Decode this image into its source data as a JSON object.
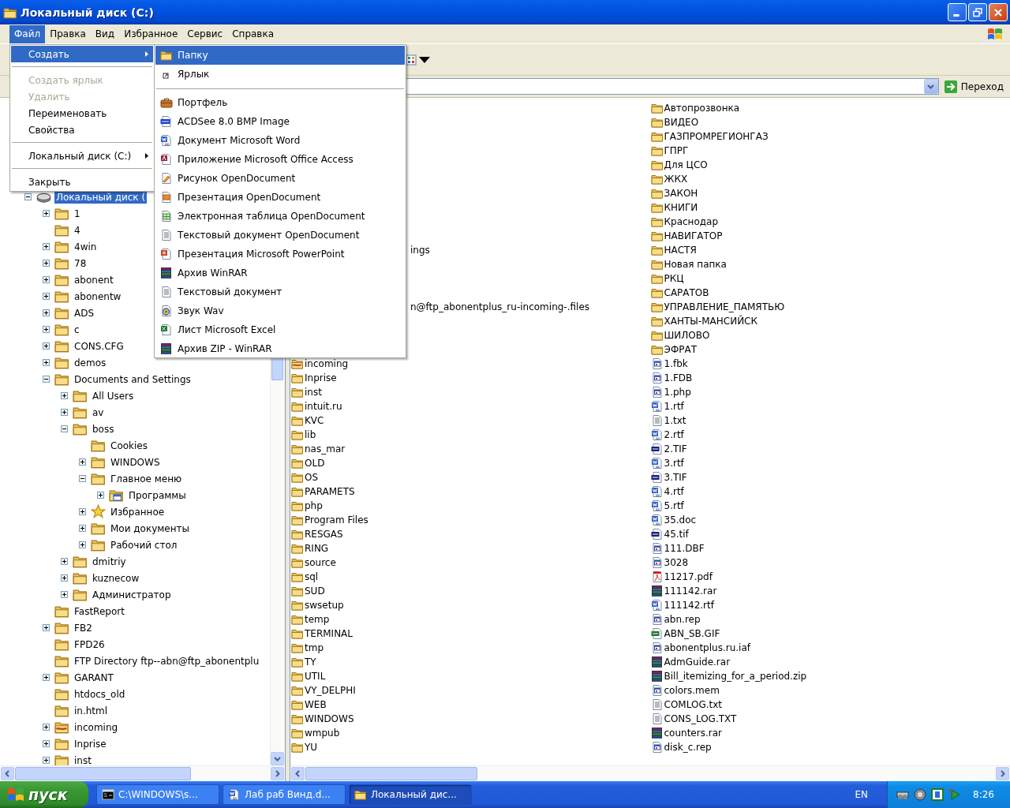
{
  "window": {
    "title": "Локальный диск (C:)"
  },
  "menu_bar": [
    {
      "label": "Файл",
      "selected": true
    },
    {
      "label": "Правка",
      "selected": false
    },
    {
      "label": "Вид",
      "selected": false
    },
    {
      "label": "Избранное",
      "selected": false
    },
    {
      "label": "Сервис",
      "selected": false
    },
    {
      "label": "Справка",
      "selected": false
    }
  ],
  "file_menu": [
    {
      "kind": "item",
      "label": "Создать",
      "highlighted": true,
      "disabled": false,
      "submenu": true
    },
    {
      "kind": "separator"
    },
    {
      "kind": "item",
      "label": "Создать ярлык",
      "highlighted": false,
      "disabled": true,
      "submenu": false
    },
    {
      "kind": "item",
      "label": "Удалить",
      "highlighted": false,
      "disabled": true,
      "submenu": false
    },
    {
      "kind": "item",
      "label": "Переименовать",
      "highlighted": false,
      "disabled": false,
      "submenu": false
    },
    {
      "kind": "item",
      "label": "Свойства",
      "highlighted": false,
      "disabled": false,
      "submenu": false
    },
    {
      "kind": "separator"
    },
    {
      "kind": "item",
      "label": "Локальный диск (C:)",
      "highlighted": false,
      "disabled": false,
      "submenu": true
    },
    {
      "kind": "separator"
    },
    {
      "kind": "item",
      "label": "Закрыть",
      "highlighted": false,
      "disabled": false,
      "submenu": false
    }
  ],
  "new_submenu": [
    {
      "kind": "folder",
      "label": "Папку",
      "highlighted": true
    },
    {
      "kind": "shortcut",
      "label": "Ярлык",
      "highlighted": false
    },
    {
      "kind": "separator"
    },
    {
      "kind": "briefcase",
      "label": "Портфель",
      "highlighted": false
    },
    {
      "kind": "bmp",
      "label": "ACDSee 8.0 BMP Image",
      "highlighted": false
    },
    {
      "kind": "word",
      "label": "Документ Microsoft Word",
      "highlighted": false
    },
    {
      "kind": "access",
      "label": "Приложение Microsoft Office Access",
      "highlighted": false
    },
    {
      "kind": "odg",
      "label": "Рисунок OpenDocument",
      "highlighted": false
    },
    {
      "kind": "odp",
      "label": "Презентация OpenDocument",
      "highlighted": false
    },
    {
      "kind": "ods",
      "label": "Электронная таблица OpenDocument",
      "highlighted": false
    },
    {
      "kind": "odt",
      "label": "Текстовый документ OpenDocument",
      "highlighted": false
    },
    {
      "kind": "ppt",
      "label": "Презентация Microsoft PowerPoint",
      "highlighted": false
    },
    {
      "kind": "rar",
      "label": "Архив WinRAR",
      "highlighted": false
    },
    {
      "kind": "text",
      "label": "Текстовый документ",
      "highlighted": false
    },
    {
      "kind": "wav",
      "label": "Звук Wav",
      "highlighted": false
    },
    {
      "kind": "excel",
      "label": "Лист Microsoft Excel",
      "highlighted": false
    },
    {
      "kind": "rar",
      "label": "Архив ZIP - WinRAR",
      "highlighted": false
    }
  ],
  "address_bar": {
    "go_button": "Переход"
  },
  "tree": {
    "items": [
      {
        "label": "Локальный диск (",
        "kind": "drive",
        "expanded": true,
        "selected": true,
        "children": [
          {
            "label": "1",
            "kind": "folder",
            "expanded": false,
            "selected": false
          },
          {
            "label": "4",
            "kind": "folder",
            "selected": false
          },
          {
            "label": "4win",
            "kind": "folder",
            "expanded": false,
            "selected": false
          },
          {
            "label": "78",
            "kind": "folder",
            "expanded": false,
            "selected": false
          },
          {
            "label": "abonent",
            "kind": "folder",
            "expanded": false,
            "selected": false
          },
          {
            "label": "abonentw",
            "kind": "folder",
            "expanded": false,
            "selected": false
          },
          {
            "label": "ADS",
            "kind": "folder",
            "expanded": false,
            "selected": false
          },
          {
            "label": "c",
            "kind": "folder",
            "expanded": false,
            "selected": false
          },
          {
            "label": "CONS.CFG",
            "kind": "folder",
            "expanded": false,
            "selected": false
          },
          {
            "label": "demos",
            "kind": "folder",
            "expanded": false,
            "selected": false
          },
          {
            "label": "Documents and Settings",
            "kind": "folder",
            "expanded": true,
            "selected": false,
            "children": [
              {
                "label": "All Users",
                "kind": "folder",
                "expanded": false,
                "selected": false
              },
              {
                "label": "av",
                "kind": "folder",
                "expanded": false,
                "selected": false
              },
              {
                "label": "boss",
                "kind": "folder",
                "expanded": true,
                "selected": false,
                "children": [
                  {
                    "label": "Cookies",
                    "kind": "folder",
                    "selected": false
                  },
                  {
                    "label": "WINDOWS",
                    "kind": "folder",
                    "expanded": false,
                    "selected": false
                  },
                  {
                    "label": "Главное меню",
                    "kind": "folder",
                    "expanded": true,
                    "selected": false,
                    "children": [
                      {
                        "label": "Программы",
                        "kind": "programs",
                        "expanded": false,
                        "selected": false
                      }
                    ]
                  },
                  {
                    "label": "Избранное",
                    "kind": "star",
                    "expanded": false,
                    "selected": false
                  },
                  {
                    "label": "Мои документы",
                    "kind": "folder",
                    "expanded": false,
                    "selected": false
                  },
                  {
                    "label": "Рабочий стол",
                    "kind": "folder",
                    "expanded": false,
                    "selected": false
                  }
                ]
              },
              {
                "label": "dmitriy",
                "kind": "folder",
                "expanded": false,
                "selected": false
              },
              {
                "label": "kuznecow",
                "kind": "folder",
                "expanded": false,
                "selected": false
              },
              {
                "label": "Администратор",
                "kind": "folder",
                "expanded": false,
                "selected": false
              }
            ]
          },
          {
            "label": "FastReport",
            "kind": "folder",
            "selected": false
          },
          {
            "label": "FB2",
            "kind": "folder",
            "expanded": false,
            "selected": false
          },
          {
            "label": "FPD26",
            "kind": "folder",
            "selected": false
          },
          {
            "label": "FTP Directory ftp--abn@ftp_abonentplu",
            "kind": "folder",
            "selected": false
          },
          {
            "label": "GARANT",
            "kind": "folder",
            "expanded": false,
            "selected": false
          },
          {
            "label": "htdocs_old",
            "kind": "folder",
            "selected": false
          },
          {
            "label": "in.html",
            "kind": "folder",
            "selected": false
          },
          {
            "label": "incoming",
            "kind": "shared-folder",
            "expanded": false,
            "selected": false
          },
          {
            "label": "Inprise",
            "kind": "folder",
            "expanded": false,
            "selected": false
          },
          {
            "label": "inst",
            "kind": "folder",
            "expanded": false,
            "selected": false
          }
        ]
      }
    ]
  },
  "file_list": {
    "column_1": [
      {
        "kind": "covered"
      },
      {
        "kind": "covered"
      },
      {
        "kind": "covered"
      },
      {
        "kind": "covered"
      },
      {
        "kind": "covered"
      },
      {
        "kind": "covered"
      },
      {
        "kind": "covered"
      },
      {
        "kind": "covered"
      },
      {
        "kind": "covered"
      },
      {
        "kind": "covered"
      },
      {
        "kind": "cut",
        "name": "ings",
        "selected": false
      },
      {
        "kind": "covered"
      },
      {
        "kind": "covered"
      },
      {
        "kind": "covered"
      },
      {
        "kind": "cut",
        "name": "n@ftp_abonentplus_ru-incoming-.files",
        "selected": false
      },
      {
        "kind": "covered"
      },
      {
        "kind": "covered"
      },
      {
        "kind": "covered"
      },
      {
        "kind": "shared-folder",
        "name": "incoming",
        "selected": false
      },
      {
        "kind": "folder",
        "name": "Inprise",
        "selected": false
      },
      {
        "kind": "folder",
        "name": "inst",
        "selected": false
      },
      {
        "kind": "folder",
        "name": "intuit.ru",
        "selected": false
      },
      {
        "kind": "folder",
        "name": "KVC",
        "selected": false
      },
      {
        "kind": "folder",
        "name": "lib",
        "selected": false
      },
      {
        "kind": "folder",
        "name": "nas_mar",
        "selected": false
      },
      {
        "kind": "folder",
        "name": "OLD",
        "selected": false
      },
      {
        "kind": "folder",
        "name": "OS",
        "selected": false
      },
      {
        "kind": "folder",
        "name": "PARAMETS",
        "selected": false
      },
      {
        "kind": "folder",
        "name": "php",
        "selected": false
      },
      {
        "kind": "folder",
        "name": "Program Files",
        "selected": false
      },
      {
        "kind": "folder",
        "name": "RESGAS",
        "selected": false
      },
      {
        "kind": "folder",
        "name": "RING",
        "selected": false
      },
      {
        "kind": "folder",
        "name": "source",
        "selected": false
      },
      {
        "kind": "folder",
        "name": "sql",
        "selected": false
      },
      {
        "kind": "folder",
        "name": "SUD",
        "selected": false
      },
      {
        "kind": "folder",
        "name": "swsetup",
        "selected": false
      },
      {
        "kind": "folder",
        "name": "temp",
        "selected": false
      },
      {
        "kind": "folder",
        "name": "TERMINAL",
        "selected": false
      },
      {
        "kind": "folder",
        "name": "tmp",
        "selected": false
      },
      {
        "kind": "folder",
        "name": "TY",
        "selected": false
      },
      {
        "kind": "folder",
        "name": "UTIL",
        "selected": false
      },
      {
        "kind": "folder",
        "name": "VY_DELPHI",
        "selected": false
      },
      {
        "kind": "folder",
        "name": "WEB",
        "selected": false
      },
      {
        "kind": "folder",
        "name": "WINDOWS",
        "selected": false
      },
      {
        "kind": "folder",
        "name": "wmpub",
        "selected": false
      },
      {
        "kind": "folder",
        "name": "YU",
        "selected": false
      }
    ],
    "column_2": [
      {
        "kind": "folder",
        "name": "Автопрозвонка",
        "selected": false
      },
      {
        "kind": "folder",
        "name": "ВИДЕО",
        "selected": false
      },
      {
        "kind": "folder",
        "name": "ГАЗПРОМРЕГИОНГАЗ",
        "selected": false
      },
      {
        "kind": "folder",
        "name": "ГПРГ",
        "selected": false
      },
      {
        "kind": "folder",
        "name": "Для ЦСО",
        "selected": false
      },
      {
        "kind": "folder",
        "name": "ЖКХ",
        "selected": false
      },
      {
        "kind": "folder",
        "name": "ЗАКОН",
        "selected": false
      },
      {
        "kind": "folder",
        "name": "КНИГИ",
        "selected": false
      },
      {
        "kind": "folder",
        "name": "Краснодар",
        "selected": false
      },
      {
        "kind": "folder",
        "name": "НАВИГАТОР",
        "selected": false
      },
      {
        "kind": "folder",
        "name": "НАСТЯ",
        "selected": false
      },
      {
        "kind": "folder",
        "name": "Новая папка",
        "selected": false
      },
      {
        "kind": "folder",
        "name": "РКЦ",
        "selected": false
      },
      {
        "kind": "folder",
        "name": "САРАТОВ",
        "selected": false
      },
      {
        "kind": "folder",
        "name": "УПРАВЛЕНИЕ_ПАМЯТЬЮ",
        "selected": false
      },
      {
        "kind": "folder",
        "name": "ХАНТЫ-МАНСИЙСК",
        "selected": false
      },
      {
        "kind": "folder",
        "name": "ШИЛОВО",
        "selected": false
      },
      {
        "kind": "folder",
        "name": "ЭФРАТ",
        "selected": false
      },
      {
        "kind": "app",
        "name": "1.fbk",
        "selected": false
      },
      {
        "kind": "app",
        "name": "1.FDB",
        "selected": false
      },
      {
        "kind": "app",
        "name": "1.php",
        "selected": false
      },
      {
        "kind": "word",
        "name": "1.rtf",
        "selected": false
      },
      {
        "kind": "text",
        "name": "1.txt",
        "selected": false
      },
      {
        "kind": "word",
        "name": "2.rtf",
        "selected": false
      },
      {
        "kind": "tif",
        "name": "2.TIF",
        "selected": false
      },
      {
        "kind": "word",
        "name": "3.rtf",
        "selected": false
      },
      {
        "kind": "tif",
        "name": "3.TIF",
        "selected": false
      },
      {
        "kind": "word",
        "name": "4.rtf",
        "selected": false
      },
      {
        "kind": "word",
        "name": "5.rtf",
        "selected": false
      },
      {
        "kind": "word",
        "name": "35.doc",
        "selected": false
      },
      {
        "kind": "tif",
        "name": "45.tif",
        "selected": false
      },
      {
        "kind": "app",
        "name": "111.DBF",
        "selected": false
      },
      {
        "kind": "app",
        "name": "3028",
        "selected": false
      },
      {
        "kind": "pdf",
        "name": "11217.pdf",
        "selected": false
      },
      {
        "kind": "rar",
        "name": "111142.rar",
        "selected": false
      },
      {
        "kind": "word",
        "name": "111142.rtf",
        "selected": false
      },
      {
        "kind": "app",
        "name": "abn.rep",
        "selected": false
      },
      {
        "kind": "gif",
        "name": "ABN_SB.GIF",
        "selected": false
      },
      {
        "kind": "app",
        "name": "abonentplus.ru.iaf",
        "selected": false
      },
      {
        "kind": "rar",
        "name": "AdmGuide.rar",
        "selected": false
      },
      {
        "kind": "rar",
        "name": "Bill_itemizing_for_a_period.zip",
        "selected": false
      },
      {
        "kind": "app",
        "name": "colors.mem",
        "selected": false
      },
      {
        "kind": "text",
        "name": "COMLOG.txt",
        "selected": false
      },
      {
        "kind": "text",
        "name": "CONS_LOG.TXT",
        "selected": false
      },
      {
        "kind": "rar",
        "name": "counters.rar",
        "selected": false
      },
      {
        "kind": "app",
        "name": "disk_c.rep",
        "selected": false
      }
    ]
  },
  "taskbar": {
    "start": "пуск",
    "tasks": [
      {
        "label": "C:\\WINDOWS\\s...",
        "kind": "console",
        "selected": false
      },
      {
        "label": "Лаб раб Винд.d...",
        "kind": "word",
        "selected": false
      },
      {
        "label": "Локальный дис...",
        "kind": "folder",
        "selected": true
      }
    ],
    "language": "EN",
    "clock": "8:26"
  }
}
